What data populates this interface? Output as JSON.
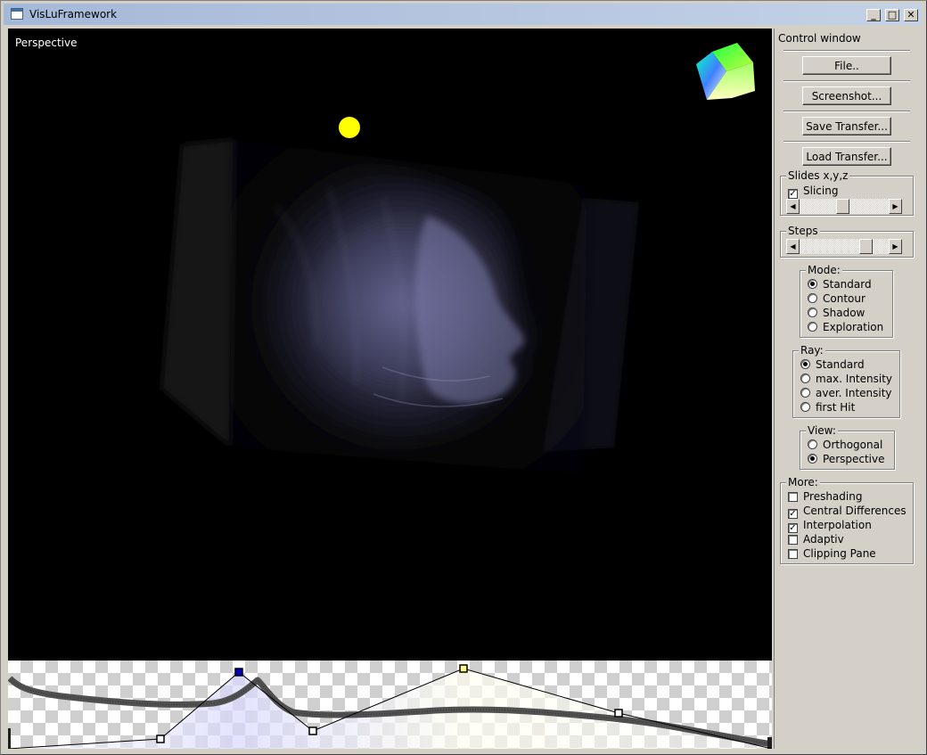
{
  "window": {
    "title": "VisLuFramework",
    "min_label": "_",
    "max_label": "□",
    "close_label": "✕"
  },
  "viewport": {
    "label": "Perspective"
  },
  "panel": {
    "title": "Control window",
    "buttons": {
      "file": "File..",
      "screenshot": "Screenshot...",
      "save_transfer": "Save Transfer...",
      "load_transfer": "Load Transfer..."
    },
    "slides": {
      "title": "Slides x,y,z",
      "slicing_label": "Slicing",
      "slicing_checked": true,
      "slider_value": 0.52
    },
    "steps": {
      "title": "Steps",
      "slider_value": 0.83
    },
    "mode": {
      "title": "Mode:",
      "options": [
        "Standard",
        "Contour",
        "Shadow",
        "Exploration"
      ],
      "selected": 0
    },
    "ray": {
      "title": "Ray:",
      "options": [
        "Standard",
        "max. Intensity",
        "aver. Intensity",
        "first Hit"
      ],
      "selected": 0
    },
    "view": {
      "title": "View:",
      "options": [
        "Orthogonal",
        "Perspective"
      ],
      "selected": 1
    },
    "more": {
      "title": "More:",
      "items": [
        {
          "label": "Preshading",
          "checked": false
        },
        {
          "label": "Central Differences",
          "checked": true
        },
        {
          "label": "Interpolation",
          "checked": true
        },
        {
          "label": "Adaptiv",
          "checked": false
        },
        {
          "label": "Clipping Pane",
          "checked": false
        }
      ]
    }
  },
  "colors": {
    "light_marker": "#ffff00",
    "control_point_selected": "#0000c0",
    "control_point_highlight": "#ffff88",
    "face_tint": "#5a5a8a"
  },
  "icons": {
    "window_icon": "app-window-icon",
    "orientation_cube": "color-cube-icon",
    "light_source": "light-sphere-icon"
  }
}
